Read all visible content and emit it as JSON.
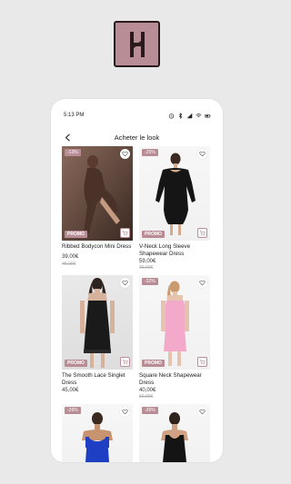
{
  "app": {
    "logo_letter": "H",
    "icon_color": "#b98d96"
  },
  "status_bar": {
    "time": "5:13 PM"
  },
  "header": {
    "title": "Acheter le look"
  },
  "products": [
    {
      "name": "Ribbed Bodycon Mini Dress",
      "discount": "-13%",
      "price": "39,00€",
      "old_price": "45,00€",
      "promo": "PROMO"
    },
    {
      "name": "V-Neck Long Sleeve Shapewear Dress",
      "discount": "-25%",
      "price": "59,00€",
      "old_price": "79,00€",
      "promo": "PROMO"
    },
    {
      "name": "The Smooth Lace Singlet Dress",
      "discount": "",
      "price": "45,00€",
      "old_price": "",
      "promo": "PROMO"
    },
    {
      "name": "Square Neck Shapewear Dress",
      "discount": "-32%",
      "price": "40,00€",
      "old_price": "59,00€",
      "promo": "PROMO"
    },
    {
      "name": "",
      "discount": "-26%",
      "price": "",
      "old_price": "",
      "promo": ""
    },
    {
      "name": "",
      "discount": "-26%",
      "price": "",
      "old_price": "",
      "promo": ""
    }
  ]
}
